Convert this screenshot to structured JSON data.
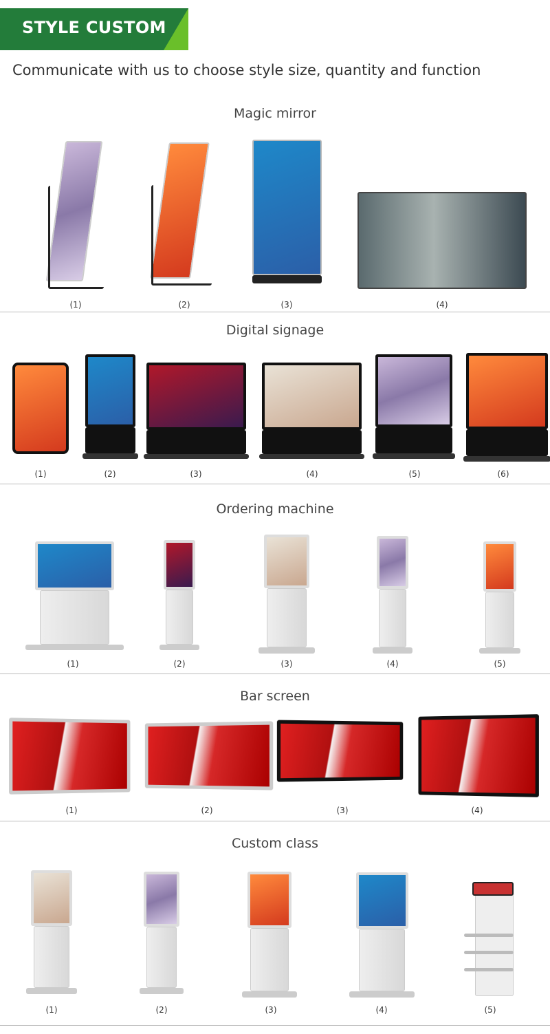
{
  "header": {
    "banner": "STYLE CUSTOM",
    "subtitle": "Communicate with us to choose style size, quantity and function",
    "colors": {
      "banner": "#237c3a",
      "accent": "#6abf2a"
    }
  },
  "sections": [
    {
      "title": "Magic mirror",
      "items": [
        "(1)",
        "(2)",
        "(3)",
        "(4)"
      ]
    },
    {
      "title": "Digital signage",
      "items": [
        "(1)",
        "(2)",
        "(3)",
        "(4)",
        "(5)",
        "(6)"
      ]
    },
    {
      "title": "Ordering machine",
      "items": [
        "(1)",
        "(2)",
        "(3)",
        "(4)",
        "(5)"
      ]
    },
    {
      "title": "Bar screen",
      "items": [
        "(1)",
        "(2)",
        "(3)",
        "(4)"
      ]
    },
    {
      "title": "Custom class",
      "items": [
        "(1)",
        "(2)",
        "(3)",
        "(4)",
        "(5)"
      ]
    }
  ]
}
